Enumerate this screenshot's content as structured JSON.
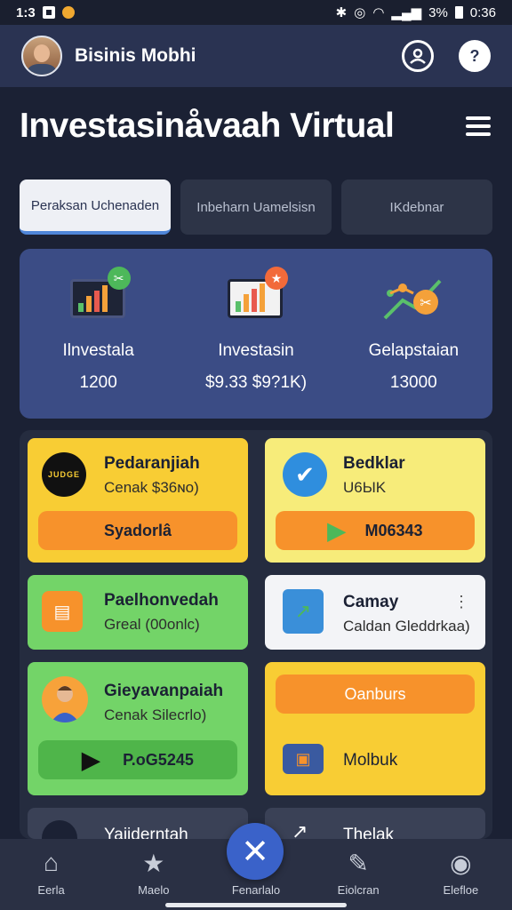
{
  "status": {
    "time_left": "1:3",
    "battery": "3%",
    "clock": "0:36"
  },
  "header": {
    "app_title": "Bisinis Mobhi"
  },
  "page": {
    "heading": "Investasinåvaah Virtual"
  },
  "tabs": [
    {
      "label": "Peraksan Uchenaden"
    },
    {
      "label": "Inbeharn Uamelsisn"
    },
    {
      "label": "IKdebnar"
    }
  ],
  "summary": [
    {
      "label": "Ilnvestala",
      "value": "1200"
    },
    {
      "label": "Investasin",
      "value": "$9.33 $9?1K)"
    },
    {
      "label": "Gelapstaian",
      "value": "13000"
    }
  ],
  "cards": {
    "c1": {
      "logo_text": "JUDGE",
      "title": "Pedaranjiah",
      "sub": "Cenak $36ɴo)",
      "button": "Syadorlâ"
    },
    "c2": {
      "title": "Bedklar",
      "sub": "U6ЫK",
      "button": "M06343"
    },
    "c3": {
      "title": "Paelhonvedah",
      "sub": "Greal (00onlc)"
    },
    "c4": {
      "title": "Camay",
      "sub": "Caldan Gleddrkaa)",
      "more": "⋮"
    },
    "c5": {
      "title": "Gieyavanpaiah",
      "sub": "Cenak Silecrlo)",
      "button": "P.oG5245"
    },
    "c6": {
      "button": "Oanburs",
      "label": "Molbuk"
    },
    "c7": {
      "title": "Yaiiderntah"
    },
    "c8": {
      "title": "Thelak"
    }
  },
  "nav": [
    {
      "label": "Eerla",
      "icon": "home-icon"
    },
    {
      "label": "Maelo",
      "icon": "star-icon"
    },
    {
      "label": "Fenarlalo",
      "icon": "close-icon"
    },
    {
      "label": "Eiolcran",
      "icon": "edit-icon"
    },
    {
      "label": "Elefloe",
      "icon": "profile-icon"
    }
  ],
  "colors": {
    "accent": "#3a62c9",
    "panel": "#3b4c85",
    "yellow": "#f8cd34",
    "orange": "#f7922b",
    "green": "#73d468"
  }
}
